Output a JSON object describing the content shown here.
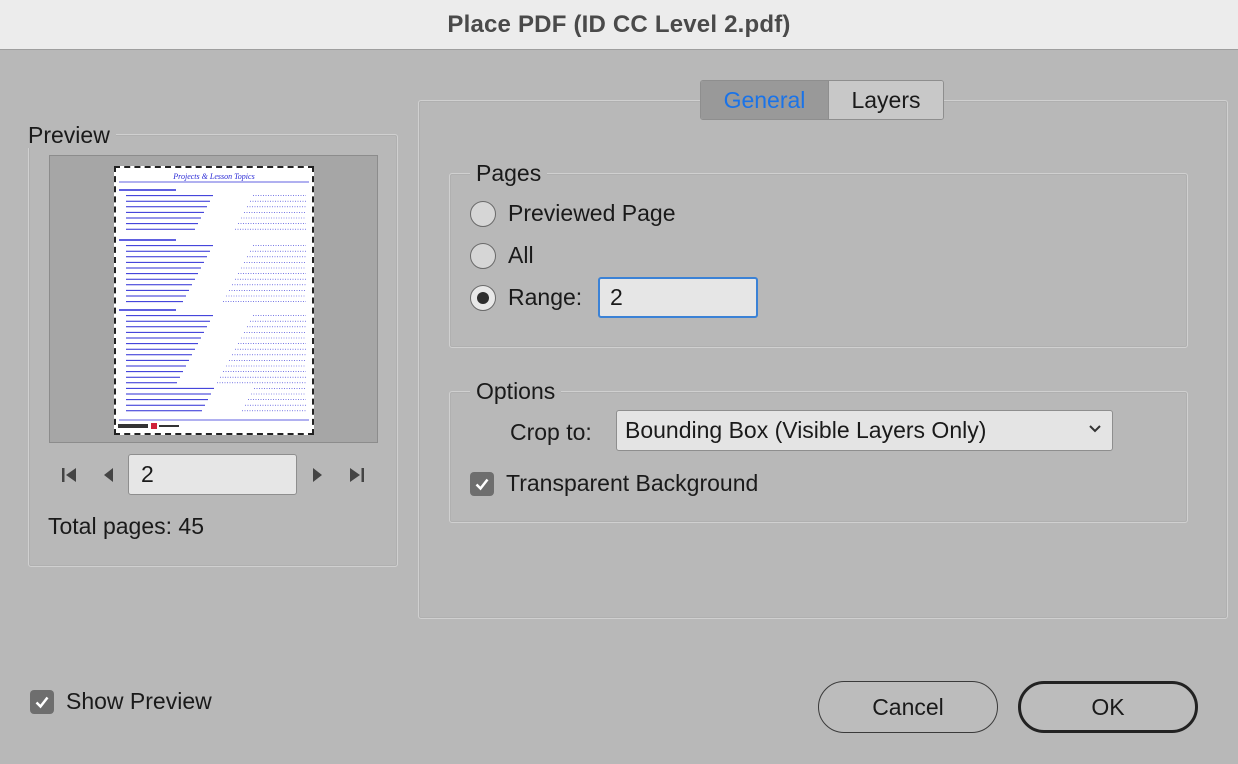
{
  "window": {
    "title": "Place PDF (ID CC Level 2.pdf)"
  },
  "preview": {
    "legend": "Preview",
    "current_page": "2",
    "total_pages_label": "Total pages: 45",
    "thumbnail_title": "Projects & Lesson Topics"
  },
  "tabs": [
    {
      "label": "General",
      "active": true
    },
    {
      "label": "Layers",
      "active": false
    }
  ],
  "pages": {
    "legend": "Pages",
    "options": [
      {
        "label": "Previewed Page",
        "checked": false
      },
      {
        "label": "All",
        "checked": false
      },
      {
        "label": "Range:",
        "checked": true
      }
    ],
    "range_value": "2"
  },
  "options": {
    "legend": "Options",
    "crop_label": "Crop to:",
    "crop_value": "Bounding Box (Visible Layers Only)",
    "transparent_background_label": "Transparent Background",
    "transparent_background_checked": true
  },
  "footer": {
    "show_preview_label": "Show Preview",
    "show_preview_checked": true,
    "cancel_label": "Cancel",
    "ok_label": "OK"
  },
  "colors": {
    "accent": "#1a73e8",
    "thumb_text": "#2b2bd6",
    "focus_ring": "#3b82d6"
  },
  "icons": [
    "first-page-icon",
    "prev-page-icon",
    "next-page-icon",
    "last-page-icon",
    "chevron-down-icon",
    "checkmark-icon"
  ]
}
